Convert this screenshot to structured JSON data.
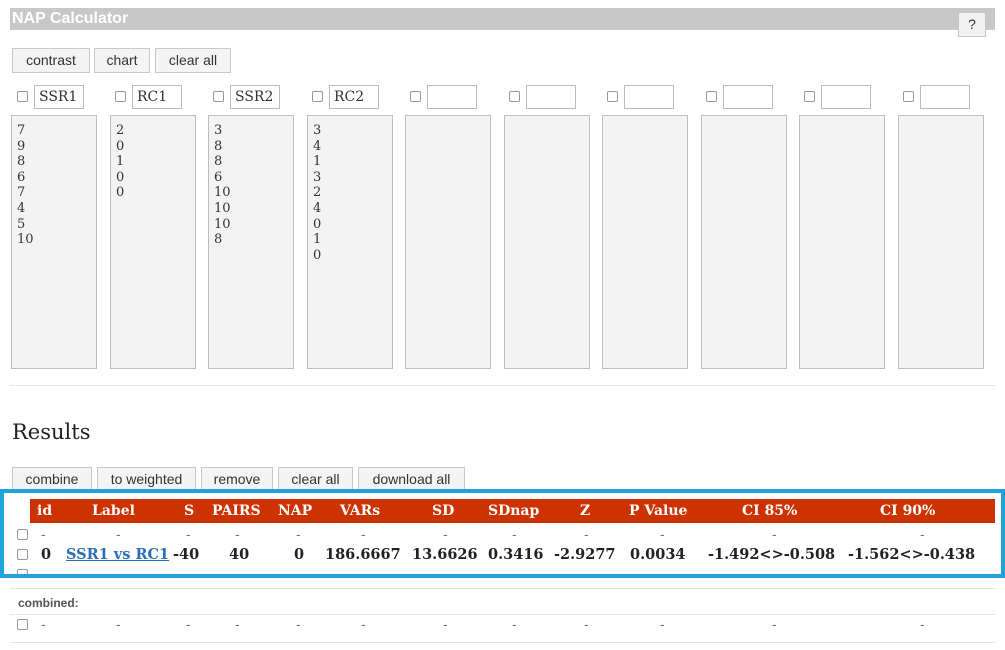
{
  "app": {
    "title": "NAP Calculator",
    "help_label": "?"
  },
  "toolbar": {
    "contrast": "contrast",
    "chart": "chart",
    "clear_all": "clear all"
  },
  "columns": [
    {
      "name": "SSR1",
      "values": "7\n9\n8\n6\n7\n4\n5\n10"
    },
    {
      "name": "RC1",
      "values": "2\n0\n1\n0\n0"
    },
    {
      "name": "SSR2",
      "values": "3\n8\n8\n6\n10\n10\n10\n8"
    },
    {
      "name": "RC2",
      "values": "3\n4\n1\n3\n2\n4\n0\n1\n0"
    },
    {
      "name": "",
      "values": ""
    },
    {
      "name": "",
      "values": ""
    },
    {
      "name": "",
      "values": ""
    },
    {
      "name": "",
      "values": ""
    },
    {
      "name": "",
      "values": ""
    },
    {
      "name": "",
      "values": ""
    }
  ],
  "results": {
    "heading": "Results",
    "buttons": {
      "combine": "combine",
      "to_weighted": "to weighted",
      "remove": "remove",
      "clear_all": "clear all",
      "download_all": "download all"
    },
    "headers": [
      "id",
      "Label",
      "S",
      "PAIRS",
      "NAP",
      "VARs",
      "SD",
      "SDnap",
      "Z",
      "P Value",
      "CI 85%",
      "CI 90%"
    ],
    "dash": "-",
    "row": {
      "id": "0",
      "label": "SSR1 vs RC1",
      "s": "-40",
      "pairs": "40",
      "nap": "0",
      "vars": "186.6667",
      "sd": "13.6626",
      "sdnap": "0.3416",
      "z": "-2.9277",
      "p_value": "0.0034",
      "ci85": "-1.492<>-0.508",
      "ci90": "-1.562<>-0.438"
    },
    "combined_label": "combined:"
  },
  "colors": {
    "header_bg": "#cc3300",
    "link": "#2a6fb7",
    "highlight": "#1ea3db",
    "title_bar": "#c8c8c8"
  }
}
